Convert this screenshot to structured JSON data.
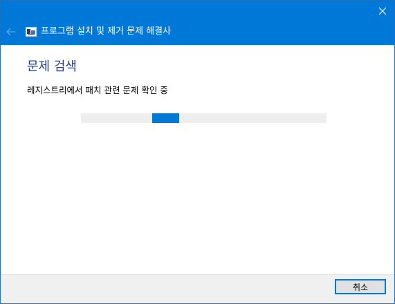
{
  "window": {
    "title": "프로그램 설치 및 제거 문제 해결사",
    "accent_color": "#0078d7",
    "icons": {
      "close": "close-icon",
      "back": "back-arrow-icon",
      "app": "troubleshooter-app-icon"
    }
  },
  "main": {
    "heading": "문제 검색",
    "status_text": "레지스트리에서 패치 관련 문제 확인 중",
    "progress": {
      "style": "indeterminate-marquee",
      "chunk_start_fraction": 0.29,
      "chunk_width_fraction": 0.11
    }
  },
  "footer": {
    "cancel_label": "취소"
  }
}
